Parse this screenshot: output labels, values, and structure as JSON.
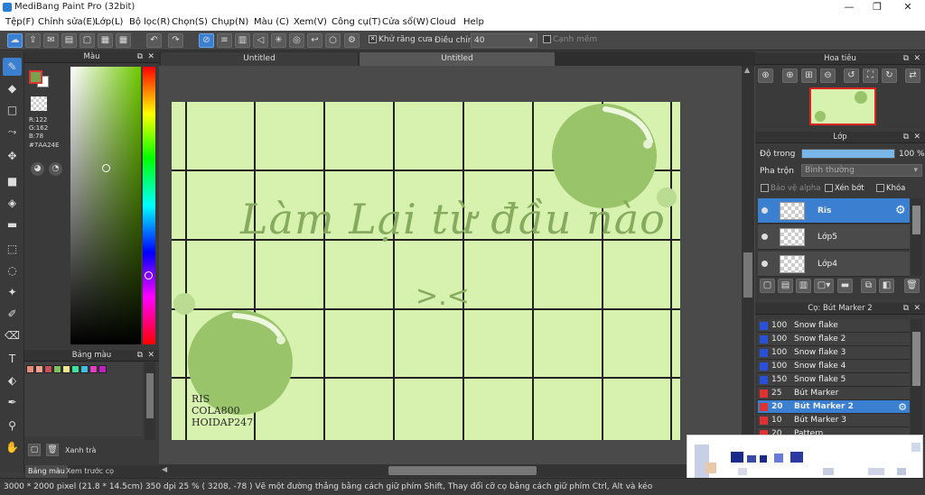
{
  "app": {
    "title": "MediBang Paint Pro (32bit)"
  },
  "window_controls": {
    "minimize": "—",
    "maximize": "❐",
    "close": "✕"
  },
  "menu": [
    "Tệp(F)",
    "Chỉnh sửa(E)",
    "Lớp(L)",
    "Bộ lọc(R)",
    "Chọn(S)",
    "Chụp(N)",
    "Màu (C)",
    "Xem(V)",
    "Công cụ(T)",
    "Cửa sổ(W)",
    "Cloud",
    "Help"
  ],
  "toolbar": {
    "antialias_label": "Khử răng cưa",
    "adjust_label": "Điều chỉnh",
    "adjust_value": "40",
    "edge_label": "Cạnh mềm"
  },
  "color_panel": {
    "title": "Màu",
    "r": "R:122",
    "g": "G:162",
    "b": "B:78",
    "hex": "#7AA24E",
    "fg_color": "#7AA24E"
  },
  "palette_panel": {
    "title": "Bảng màu",
    "item_name": "Xanh trà",
    "tabs": [
      "Bảng màu",
      "Xem trước cọ"
    ],
    "swatches": [
      "#e88c7a",
      "#f0a090",
      "#c8505a",
      "#80c060",
      "#f0e890",
      "#40e0a0",
      "#40c0e0",
      "#e040c0",
      "#c020c0"
    ]
  },
  "doc_tabs": [
    "Untitled",
    "Untitled"
  ],
  "artwork": {
    "main_text": "Làm Lại từ đầu nào",
    "emoticon": ">.<",
    "credit_lines": [
      "RIS",
      "COLA800",
      "HOIDAP247"
    ]
  },
  "navigator": {
    "title": "Hoa tiêu"
  },
  "layer_panel": {
    "title": "Lớp",
    "opacity_label": "Độ trong",
    "opacity_value": "100 %",
    "blend_label": "Pha trộn",
    "blend_value": "Bình thường",
    "protect_alpha": "Bảo vệ alpha",
    "clipping": "Xén bớt",
    "lock": "Khóa",
    "layers": [
      {
        "name": "Ris",
        "selected": true
      },
      {
        "name": "Lớp5",
        "selected": false
      },
      {
        "name": "Lớp4",
        "selected": false
      }
    ]
  },
  "brush_panel": {
    "title": "Cọ: Bút Marker 2",
    "brushes": [
      {
        "size": "100",
        "name": "Snow flake",
        "color": "#2850d8",
        "selected": false
      },
      {
        "size": "100",
        "name": "Snow flake 2",
        "color": "#2850d8",
        "selected": false
      },
      {
        "size": "100",
        "name": "Snow flake 3",
        "color": "#2850d8",
        "selected": false
      },
      {
        "size": "100",
        "name": "Snow flake 4",
        "color": "#2850d8",
        "selected": false
      },
      {
        "size": "150",
        "name": "Snow flake 5",
        "color": "#2850d8",
        "selected": false
      },
      {
        "size": "25",
        "name": "Bút Marker",
        "color": "#e03030",
        "selected": false
      },
      {
        "size": "20",
        "name": "Bút Marker 2",
        "color": "#e03030",
        "selected": true
      },
      {
        "size": "10",
        "name": "Bút Marker 3",
        "color": "#e03030",
        "selected": false
      },
      {
        "size": "20",
        "name": "Pattern",
        "color": "#e03030",
        "selected": false
      }
    ]
  },
  "status": {
    "size": "3000 * 2000 pixel  (21.8 * 14.5cm)  350 dpi  25 %  ( 3208, -78 )  Vẽ một đường thẳng bằng cách giữ phím Shift, Thay đổi cỡ cọ bằng cách giữ phím Ctrl, Alt và kéo"
  },
  "zoom_indicator": "25 %"
}
